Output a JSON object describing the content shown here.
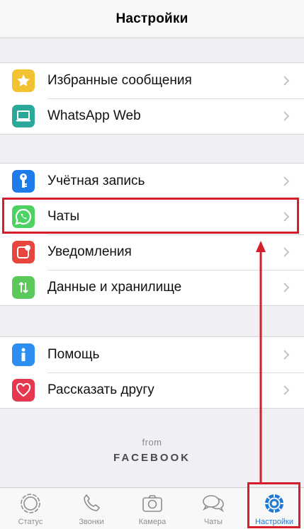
{
  "header": {
    "title": "Настройки"
  },
  "groups": [
    {
      "items": [
        {
          "label": "Избранные сообщения",
          "icon": "star-icon",
          "color": "#f2c230"
        },
        {
          "label": "WhatsApp Web",
          "icon": "laptop-icon",
          "color": "#2aa99a"
        }
      ]
    },
    {
      "items": [
        {
          "label": "Учётная запись",
          "icon": "key-icon",
          "color": "#1e7bea"
        },
        {
          "label": "Чаты",
          "icon": "whatsapp-icon",
          "color": "#4cd263"
        },
        {
          "label": "Уведомления",
          "icon": "notification-badge-icon",
          "color": "#e8453c"
        },
        {
          "label": "Данные и хранилище",
          "icon": "data-transfer-icon",
          "color": "#5ac95a"
        }
      ]
    },
    {
      "items": [
        {
          "label": "Помощь",
          "icon": "info-icon",
          "color": "#2c8ef0"
        },
        {
          "label": "Рассказать другу",
          "icon": "heart-icon",
          "color": "#e5384e"
        }
      ]
    }
  ],
  "footer": {
    "from": "from",
    "brand": "FACEBOOK"
  },
  "tabbar": {
    "tabs": [
      {
        "label": "Статус",
        "icon": "status-icon",
        "active": false
      },
      {
        "label": "Звонки",
        "icon": "phone-icon",
        "active": false
      },
      {
        "label": "Камера",
        "icon": "camera-icon",
        "active": false
      },
      {
        "label": "Чаты",
        "icon": "chats-icon",
        "active": false
      },
      {
        "label": "Настройки",
        "icon": "settings-gear-icon",
        "active": true
      }
    ]
  },
  "annotation": {
    "color": "#d41e2a"
  }
}
